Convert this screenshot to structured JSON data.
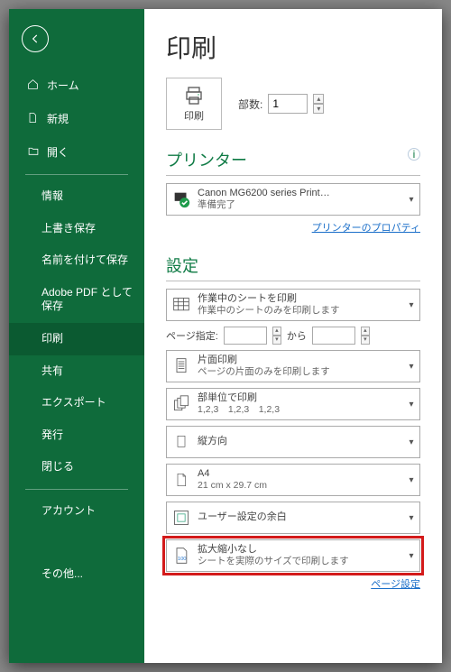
{
  "sidebar": {
    "items": [
      {
        "label": "ホーム",
        "icon": "home"
      },
      {
        "label": "新規",
        "icon": "file"
      },
      {
        "label": "開く",
        "icon": "folder"
      }
    ],
    "subitems": [
      {
        "label": "情報"
      },
      {
        "label": "上書き保存"
      },
      {
        "label": "名前を付けて保存"
      },
      {
        "label": "Adobe PDF として保存"
      },
      {
        "label": "印刷",
        "active": true
      },
      {
        "label": "共有"
      },
      {
        "label": "エクスポート"
      },
      {
        "label": "発行"
      },
      {
        "label": "閉じる"
      }
    ],
    "bottom": [
      {
        "label": "アカウント"
      },
      {
        "label": "その他..."
      }
    ]
  },
  "page": {
    "title": "印刷",
    "print_button": "印刷",
    "copies_label": "部数:",
    "copies_value": "1"
  },
  "printer": {
    "heading": "プリンター",
    "name": "Canon MG6200 series Print…",
    "status": "準備完了",
    "props_link": "プリンターのプロパティ"
  },
  "settings": {
    "heading": "設定",
    "what": {
      "title": "作業中のシートを印刷",
      "sub": "作業中のシートのみを印刷します"
    },
    "page_range": {
      "label": "ページ指定:",
      "sep": "から"
    },
    "sides": {
      "title": "片面印刷",
      "sub": "ページの片面のみを印刷します"
    },
    "collate": {
      "title": "部単位で印刷",
      "sub": "1,2,3　1,2,3　1,2,3"
    },
    "orient": {
      "title": "縦方向"
    },
    "paper": {
      "title": "A4",
      "sub": "21 cm x 29.7 cm"
    },
    "margins": {
      "title": "ユーザー設定の余白"
    },
    "scale": {
      "title": "拡大縮小なし",
      "sub": "シートを実際のサイズで印刷します"
    },
    "page_setup_link": "ページ設定"
  }
}
